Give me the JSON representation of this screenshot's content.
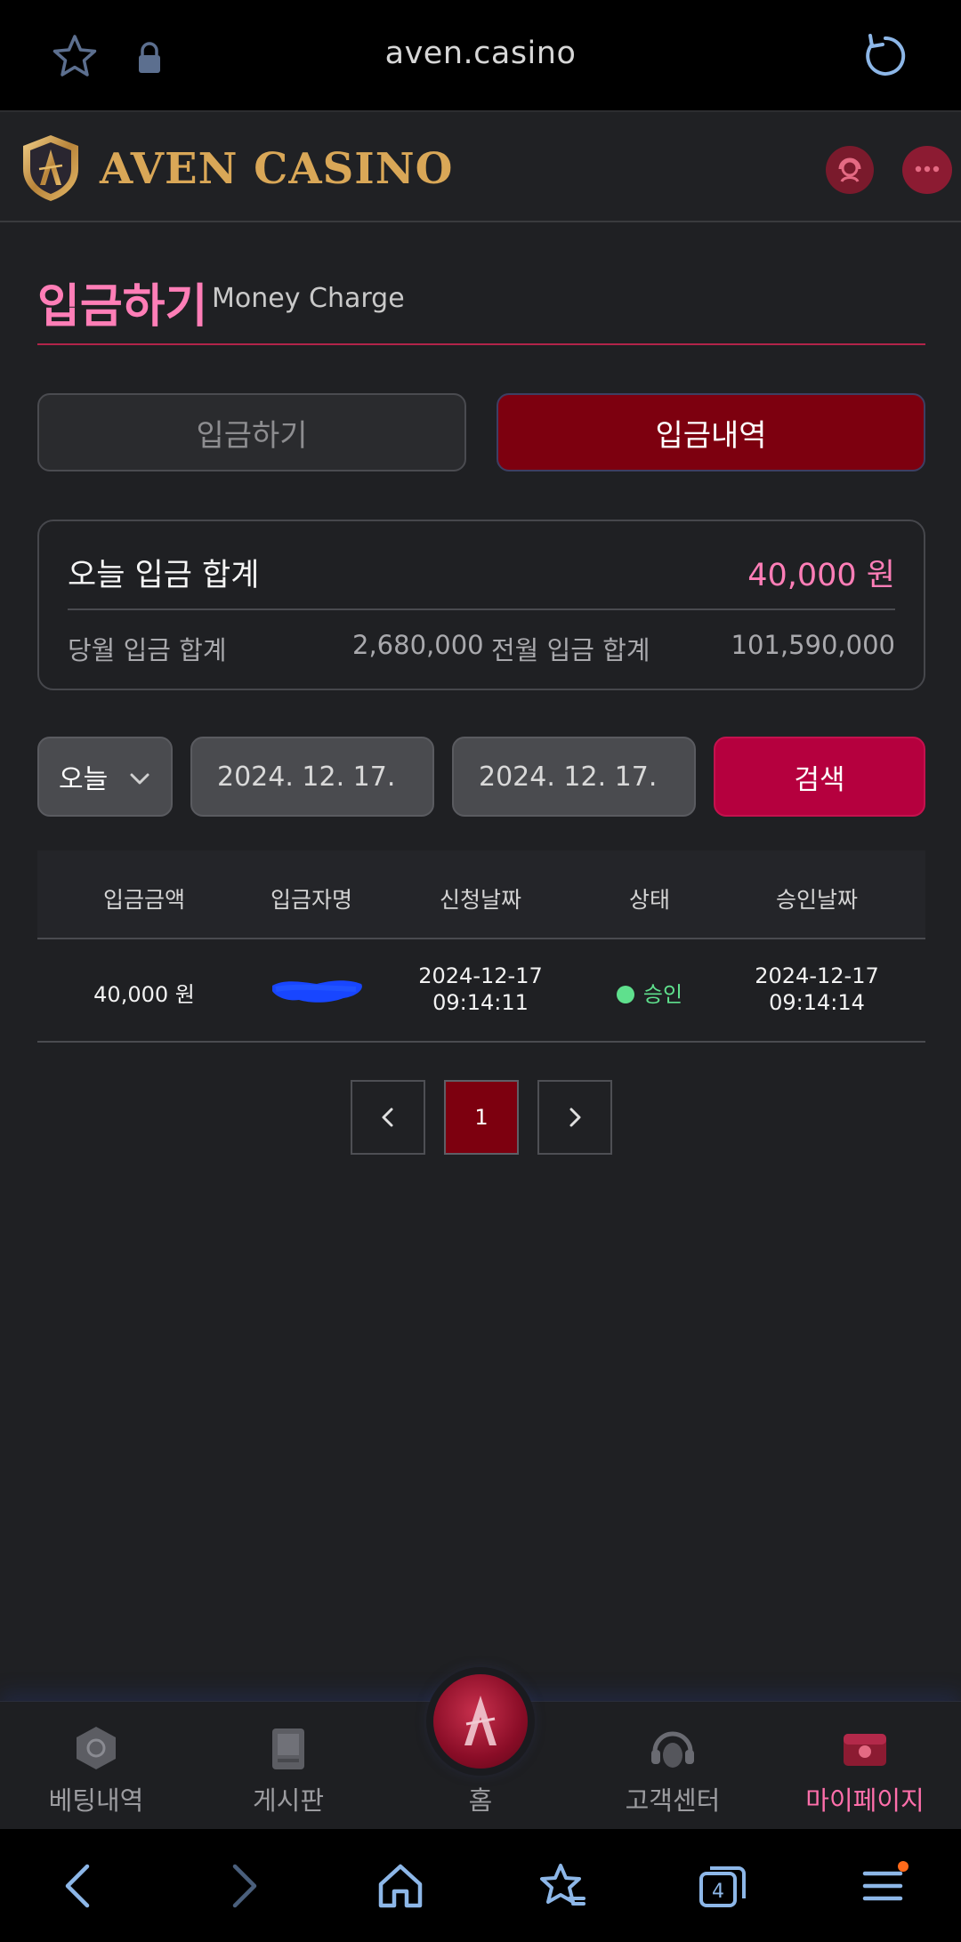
{
  "browser": {
    "url": "aven.casino"
  },
  "header": {
    "brand": "AVEN CASINO"
  },
  "page": {
    "title": "입금하기",
    "subtitle": "Money Charge"
  },
  "tabs": {
    "deposit": "입금하기",
    "history": "입금내역"
  },
  "summary": {
    "today_label": "오늘 입금 합계",
    "today_value": "40,000 원",
    "month_label": "당월 입금 합계",
    "month_value": "2,680,000",
    "prev_label": "전월 입금 합계",
    "prev_value": "101,590,000"
  },
  "filter": {
    "period": "오늘",
    "date_from": "2024. 12. 17.",
    "date_to": "2024. 12. 17.",
    "search_label": "검색"
  },
  "table": {
    "headers": [
      "입금금액",
      "입금자명",
      "신청날짜",
      "상태",
      "승인날짜"
    ],
    "rows": [
      {
        "amount": "40,000 원",
        "depositor": "",
        "request_date": "2024-12-17",
        "request_time": "09:14:11",
        "status": "승인",
        "approve_date": "2024-12-17",
        "approve_time": "09:14:14"
      }
    ]
  },
  "pagination": {
    "current": "1"
  },
  "bottom_nav": {
    "bet_history": "베팅내역",
    "board": "게시판",
    "home": "홈",
    "support": "고객센터",
    "mypage": "마이페이지"
  },
  "system_nav": {
    "tab_count": "4"
  },
  "colors": {
    "accent_pink": "#ff7eb7",
    "primary_red": "#7d000f",
    "search_red": "#b5003e",
    "status_green": "#5fe08d",
    "brand_gold": "#d9a757"
  }
}
